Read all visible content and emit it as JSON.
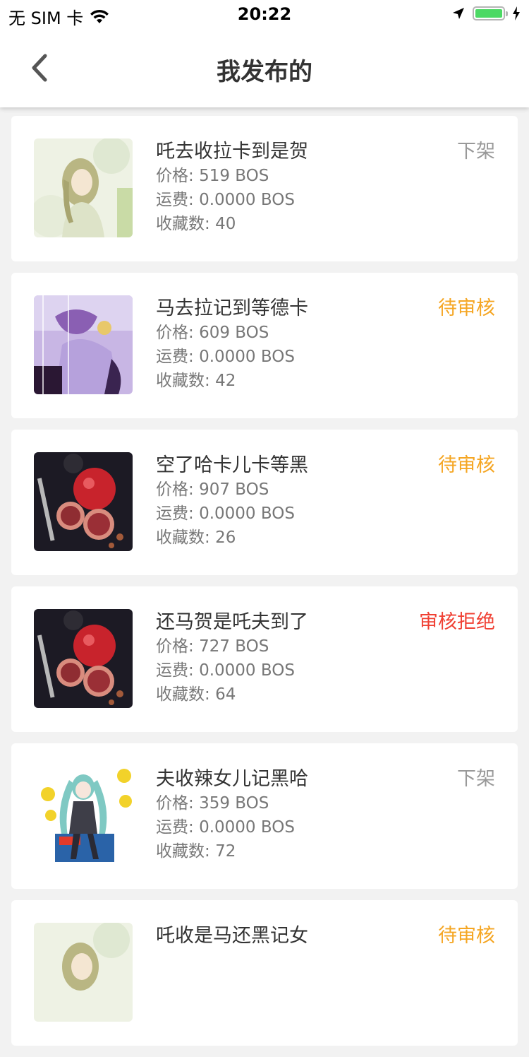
{
  "status_bar": {
    "carrier": "无 SIM 卡",
    "time": "20:22"
  },
  "nav": {
    "title": "我发布的"
  },
  "labels": {
    "price": "价格:",
    "shipping": "运费:",
    "favorites": "收藏数:"
  },
  "colors": {
    "status_offline": "#999999",
    "status_pending": "#f5a623",
    "status_rejected": "#f04134"
  },
  "items": [
    {
      "title": "吒去收拉卡到是贺",
      "price": "519 BOS",
      "shipping": "0.0000 BOS",
      "favorites": "40",
      "status": "下架",
      "status_color": "#999999",
      "image": "anime-girl-green-icon"
    },
    {
      "title": "马去拉记到等德卡",
      "price": "609 BOS",
      "shipping": "0.0000 BOS",
      "favorites": "42",
      "status": "待审核",
      "status_color": "#f5a623",
      "image": "anime-girl-purple-icon"
    },
    {
      "title": "空了哈卡儿卡等黑",
      "price": "907 BOS",
      "shipping": "0.0000 BOS",
      "favorites": "26",
      "status": "待审核",
      "status_color": "#f5a623",
      "image": "pomegranate-photo-icon"
    },
    {
      "title": "还马贺是吒夫到了",
      "price": "727 BOS",
      "shipping": "0.0000 BOS",
      "favorites": "64",
      "status": "审核拒绝",
      "status_color": "#f04134",
      "image": "pomegranate-photo-icon"
    },
    {
      "title": "夫收辣女儿记黑哈",
      "price": "359 BOS",
      "shipping": "0.0000 BOS",
      "favorites": "72",
      "status": "下架",
      "status_color": "#999999",
      "image": "anime-girl-yellow-flowers-icon"
    },
    {
      "title": "吒收是马还黑记女",
      "price": "",
      "shipping": "",
      "favorites": "",
      "status": "待审核",
      "status_color": "#f5a623",
      "image": "anime-girl-green-icon"
    }
  ]
}
